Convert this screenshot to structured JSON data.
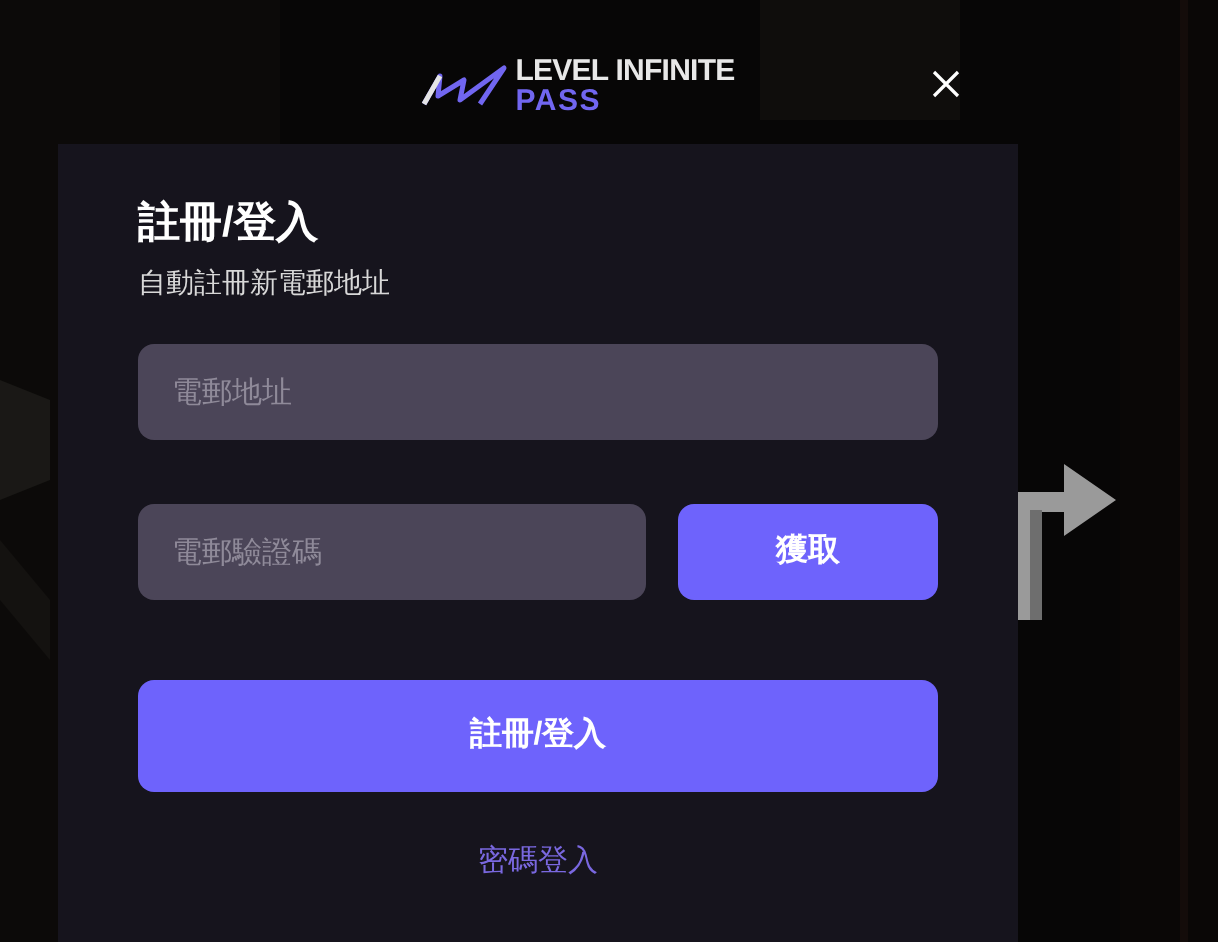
{
  "logo": {
    "line_1": "LEVEL INFINITE",
    "line_2": "PASS"
  },
  "dialog": {
    "title": "註冊/登入",
    "subtitle": "自動註冊新電郵地址",
    "email_field": {
      "placeholder": "電郵地址"
    },
    "code_field": {
      "placeholder": "電郵驗證碼"
    },
    "get_code_button": "獲取",
    "submit_button": "註冊/登入",
    "password_login_link": "密碼登入"
  }
}
